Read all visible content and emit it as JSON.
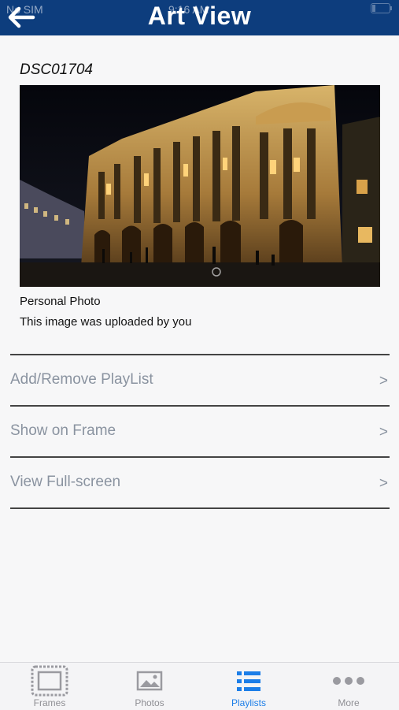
{
  "status": {
    "carrier": "No SIM",
    "time": "9:16 AM"
  },
  "header": {
    "title": "Art View",
    "back_icon": "back-arrow-icon"
  },
  "photo": {
    "name": "DSC01704",
    "category": "Personal Photo",
    "caption": "This image was uploaded by you"
  },
  "menu": [
    {
      "label": "Add/Remove PlayList",
      "chevron": ">"
    },
    {
      "label": "Show on Frame",
      "chevron": ">"
    },
    {
      "label": "View Full-screen",
      "chevron": ">"
    }
  ],
  "tabs": [
    {
      "label": "Frames",
      "icon": "frame-icon"
    },
    {
      "label": "Photos",
      "icon": "photo-icon"
    },
    {
      "label": "Playlists",
      "icon": "list-icon"
    },
    {
      "label": "More",
      "icon": "more-icon"
    }
  ],
  "colors": {
    "header": "#0d3d7d",
    "active_tab": "#1c7ee8",
    "menu_text": "#8a93a0"
  }
}
